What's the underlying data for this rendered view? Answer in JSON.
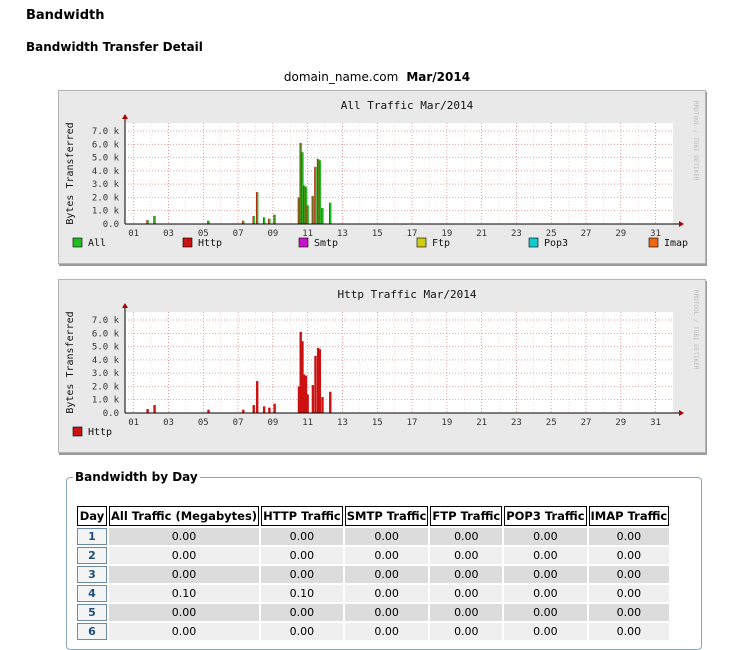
{
  "header": {
    "title": "Bandwidth",
    "subtitle": "Bandwidth Transfer Detail"
  },
  "domain": {
    "name": "domain_name.com",
    "period": "Mar/2014"
  },
  "watermark": "RRDTOOL / TOBI OETIKER",
  "chart_data": [
    {
      "type": "bar",
      "title": "All Traffic Mar/2014",
      "ylabel": "Bytes Transferred",
      "yticks": [
        "0.0",
        "1.0 k",
        "2.0 k",
        "3.0 k",
        "4.0 k",
        "5.0 k",
        "6.0 k",
        "7.0 k"
      ],
      "ylim": [
        0,
        7600
      ],
      "xticks": [
        "01",
        "03",
        "05",
        "07",
        "09",
        "11",
        "13",
        "15",
        "17",
        "19",
        "21",
        "23",
        "25",
        "27",
        "29",
        "31"
      ],
      "xlim": [
        0.5,
        32
      ],
      "grid": true,
      "legend": [
        {
          "name": "All",
          "color": "#22bb22"
        },
        {
          "name": "Http",
          "color": "#cc1111"
        },
        {
          "name": "Smtp",
          "color": "#cc11cc"
        },
        {
          "name": "Ftp",
          "color": "#cccc11"
        },
        {
          "name": "Pop3",
          "color": "#11cccc"
        },
        {
          "name": "Imap",
          "color": "#ee6611"
        }
      ],
      "series": [
        {
          "name": "All",
          "color": "#22bb22",
          "overlay": "#cc1111",
          "points": [
            [
              1.8,
              300
            ],
            [
              2.2,
              600
            ],
            [
              5.3,
              250
            ],
            [
              7.3,
              250
            ],
            [
              7.9,
              600
            ],
            [
              8.1,
              2400
            ],
            [
              8.5,
              500
            ],
            [
              8.8,
              400
            ],
            [
              9.1,
              700
            ],
            [
              10.5,
              2000
            ],
            [
              10.6,
              6100
            ],
            [
              10.7,
              5400
            ],
            [
              10.8,
              2900
            ],
            [
              10.9,
              2800
            ],
            [
              11.0,
              1400
            ],
            [
              11.3,
              2100
            ],
            [
              11.45,
              4300
            ],
            [
              11.6,
              4900
            ],
            [
              11.7,
              4800
            ],
            [
              11.85,
              1200
            ],
            [
              12.3,
              1600
            ]
          ]
        }
      ]
    },
    {
      "type": "bar",
      "title": "Http Traffic Mar/2014",
      "ylabel": "Bytes Transferred",
      "yticks": [
        "0.0",
        "1.0 k",
        "2.0 k",
        "3.0 k",
        "4.0 k",
        "5.0 k",
        "6.0 k",
        "7.0 k"
      ],
      "ylim": [
        0,
        7600
      ],
      "xticks": [
        "01",
        "03",
        "05",
        "07",
        "09",
        "11",
        "13",
        "15",
        "17",
        "19",
        "21",
        "23",
        "25",
        "27",
        "29",
        "31"
      ],
      "xlim": [
        0.5,
        32
      ],
      "grid": true,
      "legend": [
        {
          "name": "Http",
          "color": "#cc1111"
        }
      ],
      "series": [
        {
          "name": "Http",
          "color": "#cc1111",
          "points": [
            [
              1.8,
              300
            ],
            [
              2.2,
              600
            ],
            [
              5.3,
              250
            ],
            [
              7.3,
              250
            ],
            [
              7.9,
              600
            ],
            [
              8.1,
              2400
            ],
            [
              8.5,
              500
            ],
            [
              8.8,
              400
            ],
            [
              9.1,
              700
            ],
            [
              10.5,
              2000
            ],
            [
              10.6,
              6100
            ],
            [
              10.7,
              5400
            ],
            [
              10.8,
              2900
            ],
            [
              10.9,
              2800
            ],
            [
              11.0,
              1400
            ],
            [
              11.3,
              2100
            ],
            [
              11.45,
              4300
            ],
            [
              11.6,
              4900
            ],
            [
              11.7,
              4800
            ],
            [
              11.85,
              1200
            ],
            [
              12.3,
              1600
            ]
          ]
        }
      ]
    }
  ],
  "table": {
    "legend": "Bandwidth by Day",
    "headers": [
      "Day",
      "All Traffic (Megabytes)",
      "HTTP Traffic",
      "SMTP Traffic",
      "FTP Traffic",
      "POP3 Traffic",
      "IMAP Traffic"
    ],
    "rows": [
      [
        "1",
        "0.00",
        "0.00",
        "0.00",
        "0.00",
        "0.00",
        "0.00"
      ],
      [
        "2",
        "0.00",
        "0.00",
        "0.00",
        "0.00",
        "0.00",
        "0.00"
      ],
      [
        "3",
        "0.00",
        "0.00",
        "0.00",
        "0.00",
        "0.00",
        "0.00"
      ],
      [
        "4",
        "0.10",
        "0.10",
        "0.00",
        "0.00",
        "0.00",
        "0.00"
      ],
      [
        "5",
        "0.00",
        "0.00",
        "0.00",
        "0.00",
        "0.00",
        "0.00"
      ],
      [
        "6",
        "0.00",
        "0.00",
        "0.00",
        "0.00",
        "0.00",
        "0.00"
      ]
    ]
  }
}
